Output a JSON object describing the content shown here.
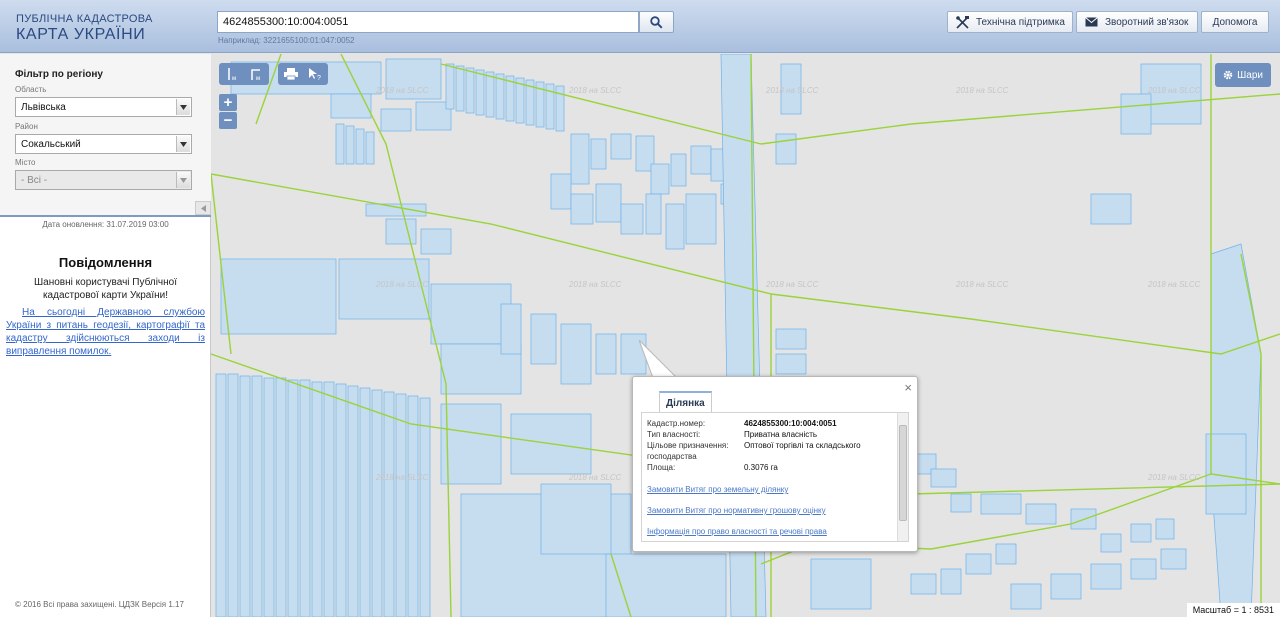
{
  "header": {
    "logo_line1": "ПУБЛІЧНА КАДАСТРОВА",
    "logo_line2": "КАРТА УКРАЇНИ",
    "search_value": "4624855300:10:004:0051",
    "search_example": "Наприклад: 3221655100:01:047:0052",
    "support_label": "Технічна підтримка",
    "feedback_label": "Зворотний зв'язок",
    "help_label": "Допомога"
  },
  "sidebar": {
    "filter_title": "Фільтр по регіону",
    "region_label": "Область",
    "region_value": "Львівська",
    "district_label": "Район",
    "district_value": "Сокальський",
    "city_label": "Місто",
    "city_value": "- Всі -",
    "update_date": "Дата оновлення: 31.07.2019 03:00",
    "notice_title": "Повідомлення",
    "notice_greeting": "Шановні користувачі Публічної кадастрової карти України!",
    "notice_link": "На сьогодні Державною службою України з питань геодезії, картографії та кадастру здійснюються заходи із виправлення помилок.",
    "copyright": "© 2016 Всі права захищені. ЦДЗК Версія 1.17"
  },
  "map": {
    "layers_label": "Шари",
    "zoom_in": "+",
    "zoom_out": "−",
    "scale": "Масштаб = 1 : 8531",
    "watermark": "2018 на SLCC"
  },
  "popup": {
    "tab_label": "Ділянка",
    "close": "×",
    "cadastral_label": "Кадастр.номер:",
    "cadastral_value": "4624855300:10:004:0051",
    "ownership_label": "Тип власності:",
    "ownership_value": "Приватна власність",
    "purpose_label": "Цільове призначення:",
    "purpose_value": "Оптової торгівлі та складського",
    "purpose_cont": "господарства",
    "area_label": "Площа:",
    "area_value": "0.3076 га",
    "link1": "Замовити Витяг про земельну ділянку",
    "link2": "Замовити Витяг про нормативну грошову оцінку",
    "link3": "Інформація про право власності та речові права"
  },
  "colors": {
    "parcel_fill": "#c6dcef",
    "parcel_stroke": "#6fb2ea",
    "boundary": "#9ad33a",
    "map_bg": "#e4e4e4",
    "header_bg": "#b9cce6",
    "tool_bg": "#6f8fbf"
  }
}
